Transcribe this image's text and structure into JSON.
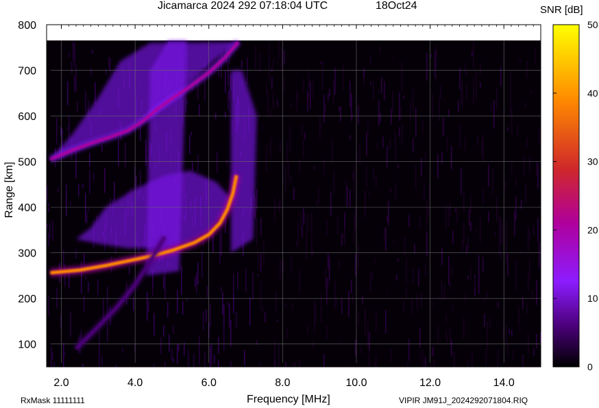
{
  "chart_data": {
    "type": "heatmap",
    "title": "Jicamarca 2024 292 07:18:04 UTC",
    "subtitle": "18Oct24",
    "xlabel": "Frequency [MHz]",
    "ylabel": "Range [km]",
    "xlim": [
      1.6,
      15.0
    ],
    "ylim": [
      50,
      800
    ],
    "data_ymax": 765,
    "x_ticks": [
      "2.0",
      "4.0",
      "6.0",
      "8.0",
      "10.0",
      "12.0",
      "14.0"
    ],
    "x_tick_values": [
      2,
      4,
      6,
      8,
      10,
      12,
      14
    ],
    "y_ticks": [
      "100",
      "200",
      "300",
      "400",
      "500",
      "600",
      "700",
      "800"
    ],
    "y_tick_values": [
      100,
      200,
      300,
      400,
      500,
      600,
      700,
      800
    ],
    "colorbar": {
      "label": "SNR [dB]",
      "range": [
        0,
        50
      ],
      "ticks": [
        "0",
        "10",
        "20",
        "30",
        "40",
        "50"
      ],
      "tick_values": [
        0,
        10,
        20,
        30,
        40,
        50
      ],
      "colors": [
        "#000000",
        "#4b007a",
        "#8c1cff",
        "#b0009c",
        "#d0282a",
        "#ff8a00",
        "#ffff00"
      ]
    },
    "traces": [
      {
        "name": "",
        "snr_db": 40,
        "points": [
          [
            1.7,
            256
          ],
          [
            2.5,
            262
          ],
          [
            3.2,
            272
          ],
          [
            3.8,
            282
          ],
          [
            4.4,
            292
          ],
          [
            5.0,
            305
          ],
          [
            5.6,
            322
          ],
          [
            6.0,
            340
          ],
          [
            6.3,
            365
          ],
          [
            6.5,
            395
          ],
          [
            6.65,
            430
          ],
          [
            6.75,
            470
          ]
        ]
      },
      {
        "name": "",
        "snr_db": 28,
        "points": [
          [
            1.7,
            505
          ],
          [
            2.3,
            525
          ],
          [
            2.8,
            540
          ],
          [
            3.3,
            553
          ],
          [
            3.8,
            568
          ],
          [
            4.2,
            588
          ],
          [
            4.6,
            615
          ],
          [
            5.0,
            638
          ],
          [
            5.5,
            665
          ],
          [
            6.0,
            695
          ],
          [
            6.4,
            725
          ],
          [
            6.8,
            762
          ]
        ]
      },
      {
        "name": "",
        "snr_db": 12,
        "points": [
          [
            2.4,
            90
          ],
          [
            2.9,
            130
          ],
          [
            3.5,
            180
          ],
          [
            4.0,
            230
          ],
          [
            4.4,
            280
          ],
          [
            4.8,
            335
          ]
        ]
      }
    ],
    "grid": true,
    "legend": "none"
  },
  "footer": {
    "rxmask": "RxMask 11111111",
    "file": "VIPIR  JM91J_2024292071804.RIQ"
  }
}
